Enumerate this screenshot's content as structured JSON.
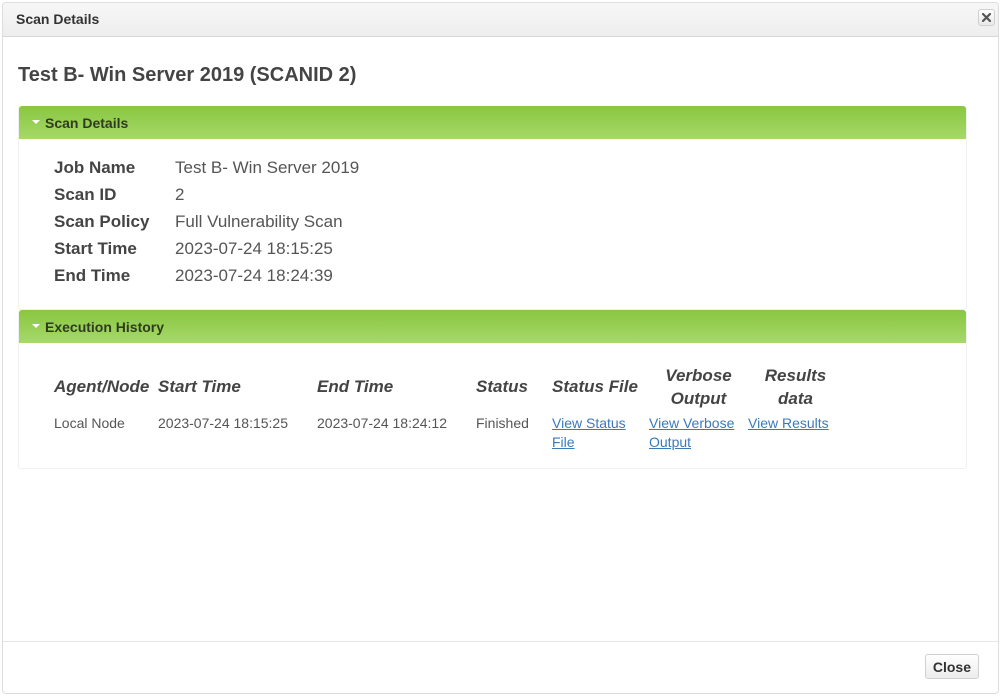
{
  "dialog": {
    "title": "Scan Details",
    "close_icon": "close-x-icon"
  },
  "page": {
    "heading": "Test B- Win Server 2019 (SCANID 2)"
  },
  "scan_details": {
    "header": "Scan Details",
    "rows": [
      {
        "label": "Job Name",
        "value": "Test B- Win Server 2019"
      },
      {
        "label": "Scan ID",
        "value": "2"
      },
      {
        "label": "Scan Policy",
        "value": "Full Vulnerability Scan"
      },
      {
        "label": "Start Time",
        "value": "2023-07-24 18:15:25"
      },
      {
        "label": "End Time",
        "value": "2023-07-24 18:24:39"
      }
    ]
  },
  "execution_history": {
    "header": "Execution History",
    "columns": [
      "Agent/Node",
      "Start Time",
      "End Time",
      "Status",
      "Status File",
      "Verbose Output",
      "Results data"
    ],
    "rows": [
      {
        "agent": "Local Node",
        "start_time": "2023-07-24 18:15:25",
        "end_time": "2023-07-24 18:24:12",
        "status": "Finished",
        "status_file_link": "View Status File",
        "verbose_link": "View Verbose Output",
        "results_link": "View Results"
      }
    ]
  },
  "footer": {
    "close_label": "Close"
  },
  "colors": {
    "panel_header_top": "#89c640",
    "panel_header_bottom": "#a6d96a",
    "link": "#3b7ab8"
  }
}
